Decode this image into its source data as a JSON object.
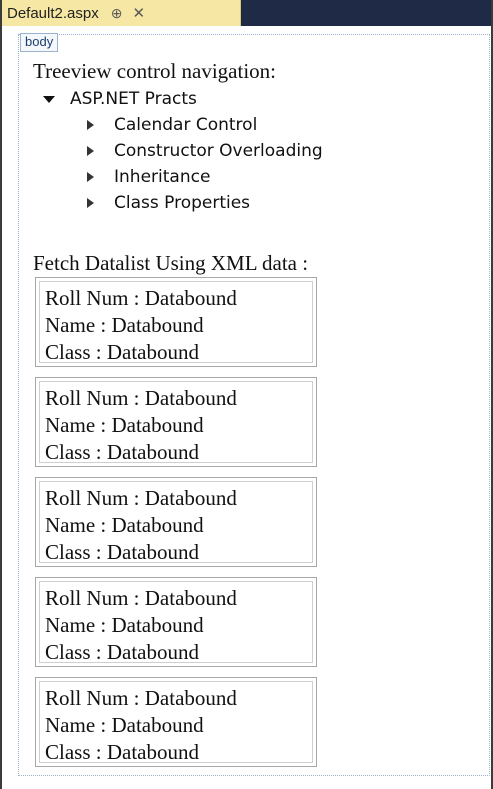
{
  "tab": {
    "title": "Default2.aspx",
    "pin_glyph": "⊕",
    "close_glyph": "✕"
  },
  "design": {
    "body_tag": "body"
  },
  "treeview": {
    "heading": "Treeview control navigation:",
    "root": "ASP.NET Practs",
    "children": [
      "Calendar Control",
      "Constructor Overloading",
      "Inheritance",
      "Class Properties"
    ]
  },
  "datalist": {
    "heading": "Fetch Datalist Using XML data :",
    "items": [
      {
        "roll": "Roll Num : Databound",
        "name": "Name : Databound",
        "class": "Class : Databound"
      },
      {
        "roll": "Roll Num : Databound",
        "name": "Name : Databound",
        "class": "Class : Databound"
      },
      {
        "roll": "Roll Num : Databound",
        "name": "Name : Databound",
        "class": "Class : Databound"
      },
      {
        "roll": "Roll Num : Databound",
        "name": "Name : Databound",
        "class": "Class : Databound"
      },
      {
        "roll": "Roll Num : Databound",
        "name": "Name : Databound",
        "class": "Class : Databound"
      }
    ]
  },
  "colors": {
    "tabstrip": "#1f2a47",
    "active_tab": "#f6e7a5",
    "surface_border": "#9bb3cc"
  }
}
